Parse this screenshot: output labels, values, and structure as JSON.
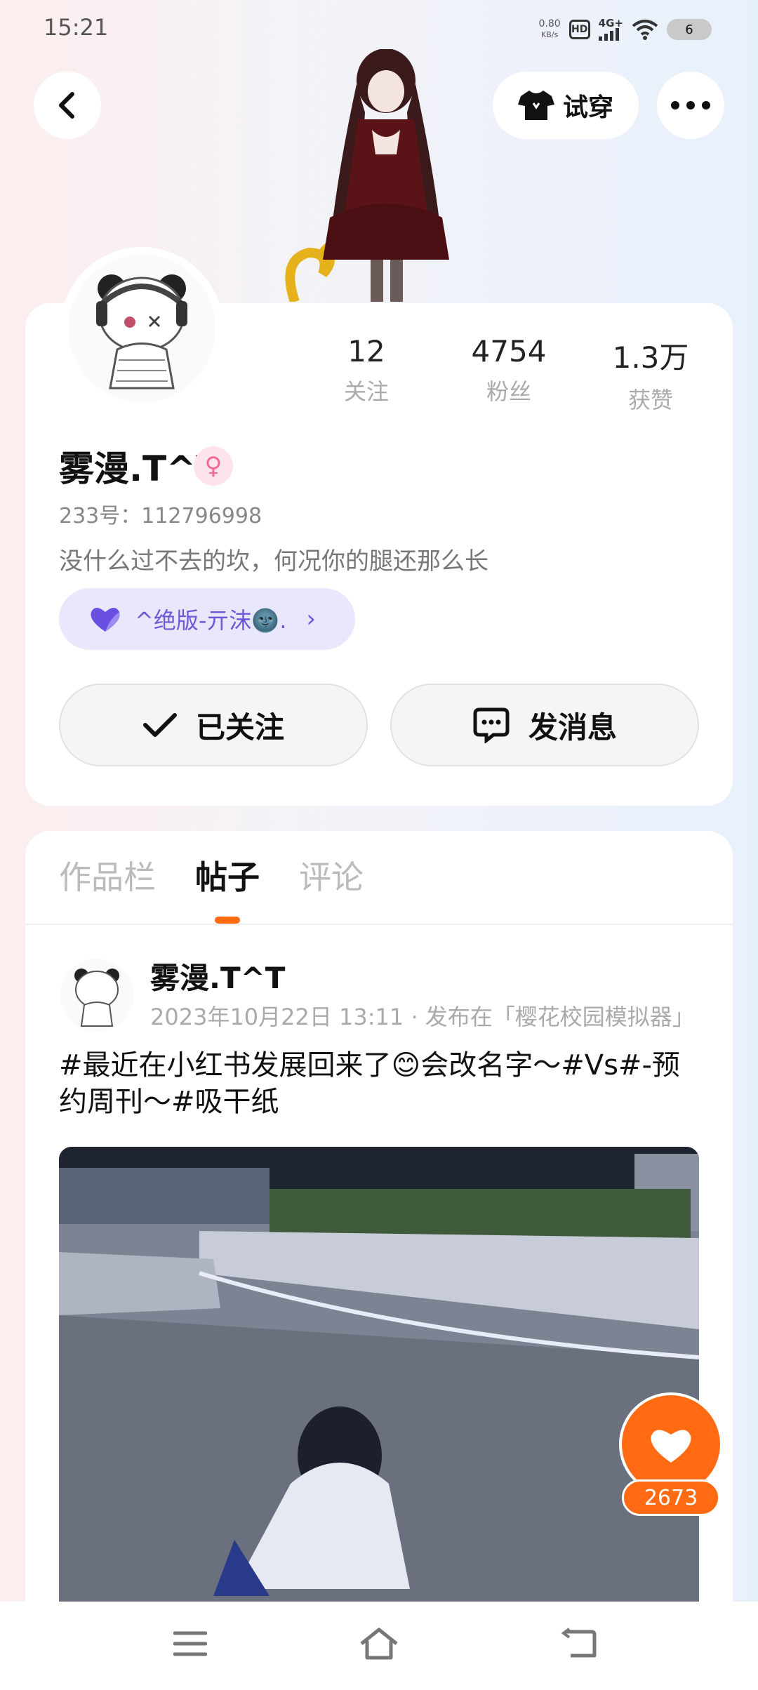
{
  "status_bar": {
    "time": "15:21",
    "net_speed_value": "0.80",
    "net_speed_unit": "KB/s",
    "hd_label": "HD",
    "signal_label": "4G+",
    "battery": "6"
  },
  "header": {
    "try_on_label": "试穿"
  },
  "profile": {
    "stats": [
      {
        "value": "12",
        "label": "关注"
      },
      {
        "value": "4754",
        "label": "粉丝"
      },
      {
        "value": "1.3万",
        "label": "获赞"
      }
    ],
    "username": "雾漫.T^T",
    "gender_symbol": "♀",
    "uid": "233号：112796998",
    "bio": "没什么过不去的坎，何况你的腿还那么长",
    "club_label": "^绝版-亓沫🌚.",
    "follow_button_label": "已关注",
    "message_button_label": "发消息"
  },
  "tabs": [
    {
      "label": "作品栏",
      "active": false
    },
    {
      "label": "帖子",
      "active": true
    },
    {
      "label": "评论",
      "active": false
    }
  ],
  "post": {
    "author": "雾漫.T^T",
    "meta": "2023年10月22日 13:11 · 发布在「樱花校园模拟器」",
    "text": "#最近在小红书发展回来了😊会改名字～#Vs#-预约周刊～#吸干纸",
    "like_count": "2673"
  },
  "colors": {
    "accent": "#ff6a13",
    "club_bg": "#e9e7fb",
    "club_text": "#6a5ad8",
    "gender_pink": "#f06a95"
  }
}
